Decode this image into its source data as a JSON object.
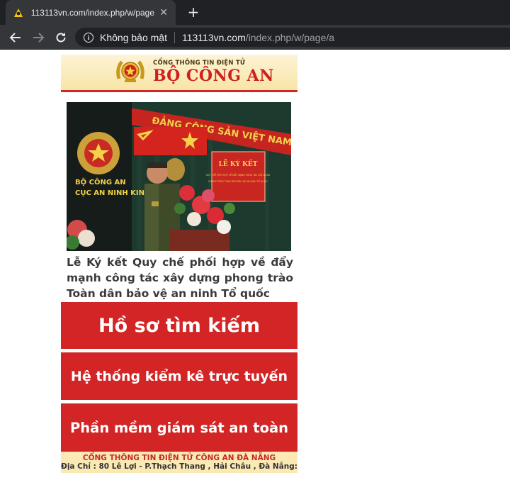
{
  "browser": {
    "tab_title": "113113vn.com/index.php/w/page/a",
    "close_glyph": "✕",
    "newtab_glyph": "+",
    "security_label": "Không bảo mật",
    "url_host": "113113vn.com",
    "url_path": "/index.php/w/page/a"
  },
  "header": {
    "subtitle": "CỔNG THÔNG TIN ĐIỆN TỬ",
    "title": "BỘ CÔNG AN"
  },
  "photo": {
    "banner_text": "ĐẢNG CỘNG SẢN VIỆT NAM QUANG VINH MUÔN NĂM",
    "emblem_line1": "BỘ CÔNG AN",
    "emblem_line2": "CỤC AN NINH KINH",
    "screen_line1": "LỄ KÝ KẾT",
    "screen_line2": "QUY CHẾ PHỐI HỢP VỀ ĐẨY MẠNH CÔNG TÁC XÂY DỰNG",
    "screen_line3": "PHONG TRÀO TOÀN DÂN BẢO VỆ AN NINH TỔ QUỐC"
  },
  "headline": "Lễ Ký kết Quy chế phối hợp về đẩy mạnh công tác xây dựng phong trào Toàn dân bảo vệ an ninh Tổ quốc",
  "buttons": {
    "search_records": "Hồ sơ tìm kiếm",
    "online_inventory": "Hệ thống kiểm kê trực tuyến",
    "safety_monitor": "Phần mềm giám sát an toàn"
  },
  "footer": {
    "line1": "CỔNG THÔNG TIN ĐIỆN TỬ CÔNG AN ĐÀ NẴNG",
    "line2": "Địa Chỉ : 80 Lê Lợi - P.Thạch Thang , Hải Châu , Đà Nẵng:"
  },
  "colors": {
    "brand_red": "#d32525",
    "banner_gold": "#f7e5a6",
    "chrome_dark": "#202124"
  }
}
